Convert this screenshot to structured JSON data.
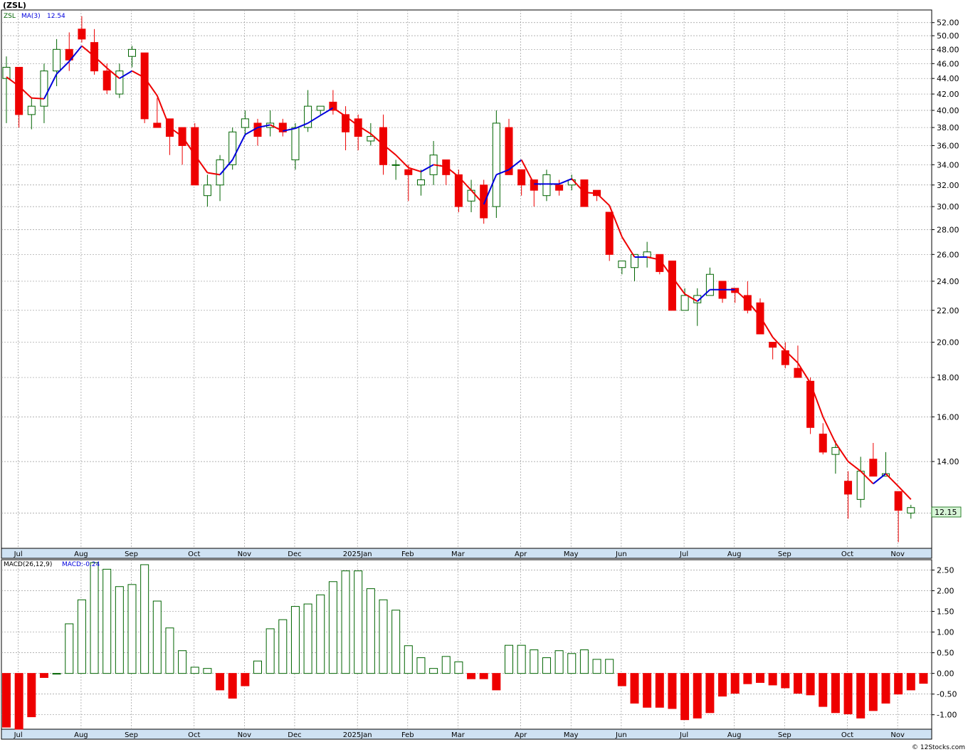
{
  "title": "(ZSL)",
  "price_panel": {
    "legend_symbol": "ZSL",
    "legend_ma": "MA(3)",
    "legend_ma_value": "12.54",
    "y_ticks": [
      "52.00",
      "50.00",
      "48.00",
      "46.00",
      "44.00",
      "42.00",
      "40.00",
      "38.00",
      "36.00",
      "34.00",
      "32.00",
      "30.00",
      "28.00",
      "26.00",
      "24.00",
      "22.00",
      "20.00",
      "18.00",
      "16.00",
      "14.00"
    ],
    "last_price": "12.15"
  },
  "macd_panel": {
    "legend_name": "MACD(26,12,9)",
    "legend_value": "MACD:-0.24",
    "y_ticks": [
      "2.50",
      "2.00",
      "1.50",
      "1.00",
      "0.50",
      "0.00",
      "-0.50",
      "-1.00"
    ]
  },
  "x_months": [
    "Jul",
    "Aug",
    "Sep",
    "Oct",
    "Nov",
    "Dec",
    "2025Jan",
    "Feb",
    "Mar",
    "Apr",
    "May",
    "Jun",
    "Jul",
    "Aug",
    "Sep",
    "Oct",
    "Nov"
  ],
  "footer": "© 12Stocks.com",
  "colors": {
    "up": "#006400",
    "down": "#ee0000",
    "ma_up": "#0000dd",
    "ma_down": "#ee0000",
    "macd_pos": "#006400",
    "macd_neg": "#ee0000"
  },
  "chart_data": [
    {
      "type": "candlestick",
      "title": "(ZSL)",
      "period": "weekly",
      "y_scale": "log",
      "ylim": [
        10.8,
        54.0
      ],
      "series_ma_name": "MA(3)",
      "ohlc": [
        [
          44.0,
          47.0,
          38.5,
          45.5
        ],
        [
          45.5,
          45.5,
          38.0,
          39.5
        ],
        [
          39.5,
          41.5,
          37.8,
          40.5
        ],
        [
          40.5,
          46.0,
          38.5,
          45.0
        ],
        [
          45.0,
          49.5,
          43.0,
          48.0
        ],
        [
          48.0,
          50.5,
          45.0,
          46.5
        ],
        [
          51.0,
          53.0,
          49.0,
          49.5
        ],
        [
          49.0,
          51.0,
          44.5,
          45.0
        ],
        [
          45.0,
          46.0,
          42.0,
          42.5
        ],
        [
          42.0,
          46.0,
          41.5,
          45.0
        ],
        [
          47.0,
          48.5,
          45.5,
          48.0
        ],
        [
          47.5,
          47.5,
          38.5,
          39.0
        ],
        [
          38.5,
          41.5,
          38.0,
          38.0
        ],
        [
          39.0,
          39.0,
          35.0,
          37.0
        ],
        [
          38.0,
          38.0,
          34.0,
          36.0
        ],
        [
          38.0,
          38.5,
          32.0,
          32.0
        ],
        [
          31.0,
          33.0,
          30.0,
          32.0
        ],
        [
          32.0,
          35.0,
          30.5,
          34.5
        ],
        [
          34.0,
          38.0,
          33.5,
          37.5
        ],
        [
          38.0,
          40.0,
          37.0,
          39.0
        ],
        [
          38.5,
          39.0,
          36.0,
          37.0
        ],
        [
          38.0,
          40.0,
          37.0,
          38.5
        ],
        [
          38.5,
          39.0,
          37.0,
          37.5
        ],
        [
          34.5,
          38.5,
          33.5,
          38.0
        ],
        [
          38.0,
          42.5,
          37.5,
          40.5
        ],
        [
          40.0,
          40.5,
          39.5,
          40.5
        ],
        [
          41.0,
          42.5,
          39.5,
          40.0
        ],
        [
          39.5,
          40.5,
          35.5,
          37.5
        ],
        [
          39.0,
          39.5,
          35.5,
          37.0
        ],
        [
          36.5,
          38.5,
          36.0,
          37.0
        ],
        [
          38.0,
          39.5,
          33.0,
          34.0
        ],
        [
          34.0,
          34.5,
          32.5,
          34.0
        ],
        [
          33.5,
          34.0,
          30.5,
          33.0
        ],
        [
          32.0,
          33.5,
          31.0,
          32.5
        ],
        [
          33.0,
          36.5,
          32.0,
          35.0
        ],
        [
          34.5,
          34.5,
          32.0,
          33.0
        ],
        [
          33.0,
          33.5,
          29.5,
          30.0
        ],
        [
          30.5,
          32.5,
          29.5,
          31.5
        ],
        [
          32.0,
          32.5,
          28.5,
          29.0
        ],
        [
          30.0,
          40.0,
          29.0,
          38.5
        ],
        [
          38.0,
          39.0,
          33.0,
          33.0
        ],
        [
          33.5,
          33.5,
          31.0,
          32.0
        ],
        [
          32.5,
          32.5,
          30.0,
          31.5
        ],
        [
          31.0,
          33.5,
          30.5,
          33.0
        ],
        [
          32.0,
          32.5,
          31.0,
          31.5
        ],
        [
          32.0,
          33.0,
          31.5,
          32.5
        ],
        [
          32.5,
          32.5,
          30.0,
          30.0
        ],
        [
          31.5,
          31.5,
          30.5,
          31.0
        ],
        [
          29.5,
          29.5,
          25.5,
          26.0
        ],
        [
          25.0,
          25.5,
          24.5,
          25.5
        ],
        [
          25.0,
          26.0,
          24.0,
          26.0
        ],
        [
          25.8,
          27.0,
          25.0,
          26.2
        ],
        [
          26.0,
          26.0,
          24.5,
          24.7
        ],
        [
          25.5,
          25.5,
          22.0,
          22.0
        ],
        [
          22.0,
          23.5,
          22.0,
          23.0
        ],
        [
          22.5,
          23.5,
          21.0,
          23.0
        ],
        [
          23.0,
          25.0,
          23.0,
          24.5
        ],
        [
          24.0,
          24.0,
          22.5,
          22.8
        ],
        [
          23.5,
          23.5,
          22.5,
          23.2
        ],
        [
          23.0,
          24.0,
          21.8,
          22.0
        ],
        [
          22.5,
          22.8,
          20.5,
          20.5
        ],
        [
          20.0,
          20.0,
          19.0,
          19.7
        ],
        [
          19.5,
          20.0,
          18.5,
          18.7
        ],
        [
          18.5,
          19.8,
          18.0,
          18.0
        ],
        [
          17.8,
          18.0,
          15.2,
          15.5
        ],
        [
          15.2,
          15.7,
          14.3,
          14.4
        ],
        [
          14.3,
          14.9,
          13.5,
          14.6
        ],
        [
          13.2,
          13.6,
          11.8,
          12.7
        ],
        [
          12.5,
          14.2,
          12.2,
          13.6
        ],
        [
          14.1,
          14.8,
          13.4,
          13.4
        ],
        [
          13.4,
          14.4,
          13.4,
          13.5
        ],
        [
          12.8,
          12.8,
          11.0,
          12.1
        ],
        [
          12.0,
          12.3,
          11.8,
          12.2
        ]
      ],
      "ma": [
        44.2,
        43.0,
        41.5,
        41.4,
        44.6,
        46.3,
        48.5,
        47.0,
        45.4,
        44.0,
        45.0,
        44.1,
        41.8,
        38.0,
        37.0,
        35.0,
        33.2,
        33.0,
        34.5,
        37.2,
        38.0,
        38.3,
        37.6,
        37.9,
        38.5,
        39.4,
        40.3,
        39.3,
        38.2,
        37.3,
        36.1,
        35.0,
        33.7,
        33.3,
        34.0,
        33.8,
        32.8,
        31.5,
        30.2,
        33.0,
        33.5,
        34.5,
        32.1,
        32.1,
        32.1,
        32.6,
        31.3,
        31.2,
        30.1,
        27.4,
        25.8,
        25.8,
        25.6,
        24.3,
        23.1,
        22.6,
        23.4,
        23.4,
        23.4,
        22.6,
        21.6,
        20.3,
        19.5,
        18.8,
        17.7,
        16.0,
        14.8,
        14.0,
        13.6,
        13.1,
        13.5,
        13.0,
        12.5
      ]
    },
    {
      "type": "bar",
      "title": "MACD(26,12,9)",
      "ylim": [
        -1.35,
        2.75
      ],
      "values": [
        -1.3,
        -1.35,
        -1.05,
        -0.1,
        0.0,
        1.2,
        1.78,
        2.68,
        2.52,
        2.1,
        2.15,
        2.63,
        1.75,
        1.1,
        0.55,
        0.15,
        0.12,
        -0.4,
        -0.6,
        -0.3,
        0.3,
        1.08,
        1.3,
        1.62,
        1.68,
        1.9,
        2.22,
        2.48,
        2.48,
        2.05,
        1.78,
        1.53,
        0.67,
        0.38,
        0.12,
        0.41,
        0.28,
        -0.13,
        -0.13,
        -0.4,
        0.68,
        0.68,
        0.57,
        0.38,
        0.55,
        0.48,
        0.57,
        0.34,
        0.34,
        -0.3,
        -0.72,
        -0.82,
        -0.82,
        -0.85,
        -1.12,
        -1.08,
        -0.95,
        -0.55,
        -0.48,
        -0.25,
        -0.22,
        -0.28,
        -0.35,
        -0.48,
        -0.52,
        -0.8,
        -0.95,
        -0.98,
        -1.08,
        -0.9,
        -0.72,
        -0.5,
        -0.4,
        -0.24
      ]
    }
  ]
}
